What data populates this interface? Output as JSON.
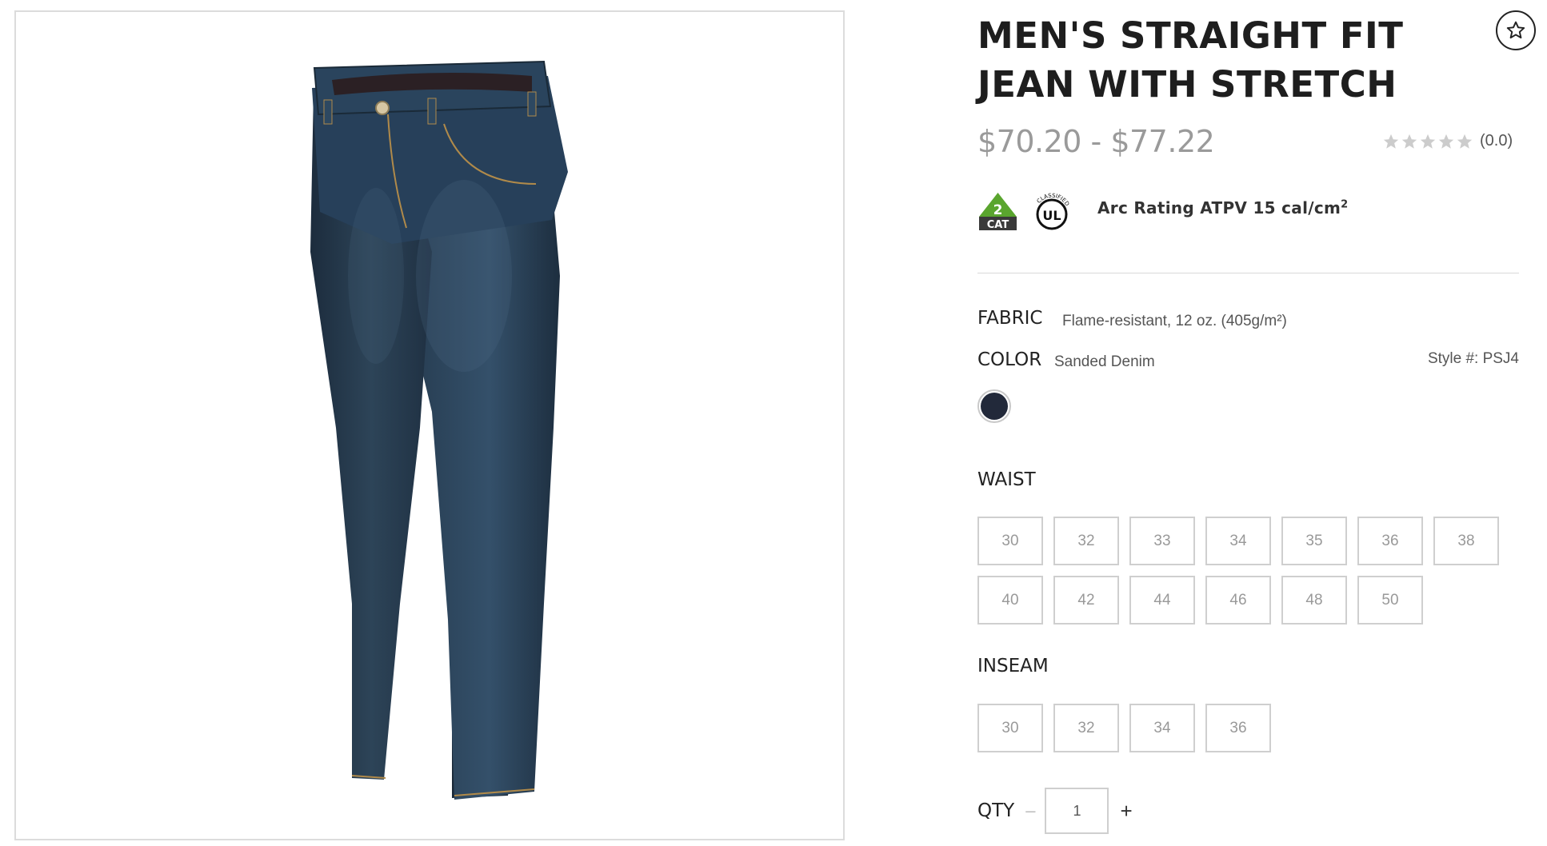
{
  "product": {
    "title": "MEN'S STRAIGHT FIT JEAN WITH STRETCH",
    "price_range": "$70.20 - $77.22",
    "rating_text": "(0.0)",
    "rating_value": 0.0,
    "rating_max": 5,
    "image_alt": "Men's straight fit jean, dark sanded denim",
    "wishlist_icon": "star-outline-icon"
  },
  "certifications": {
    "cat_number": "2",
    "cat_label": "CAT",
    "ul_text": "UL",
    "ul_ring_text": "CLASSIFIED",
    "arc_rating": "Arc Rating ATPV 15 cal/cm",
    "arc_unit_sup": "2"
  },
  "fabric": {
    "label": "FABRIC",
    "value": "Flame-resistant, 12 oz. (405g/m²)"
  },
  "color": {
    "label": "COLOR",
    "value": "Sanded Denim",
    "swatch_hex": "#22293a",
    "style_number": "Style #: PSJ4"
  },
  "waist": {
    "label": "WAIST",
    "options": [
      "30",
      "32",
      "33",
      "34",
      "35",
      "36",
      "38",
      "40",
      "42",
      "44",
      "46",
      "48",
      "50"
    ]
  },
  "inseam": {
    "label": "INSEAM",
    "options": [
      "30",
      "32",
      "34",
      "36"
    ]
  },
  "quantity": {
    "label": "QTY",
    "minus": "–",
    "plus": "+",
    "value": "1"
  },
  "colors": {
    "cat_green": "#5aa52e",
    "cat_dark": "#3a3a3a",
    "price_gray": "#9a9a9a",
    "star_gray": "#cccccc",
    "denim": "#26384c"
  }
}
